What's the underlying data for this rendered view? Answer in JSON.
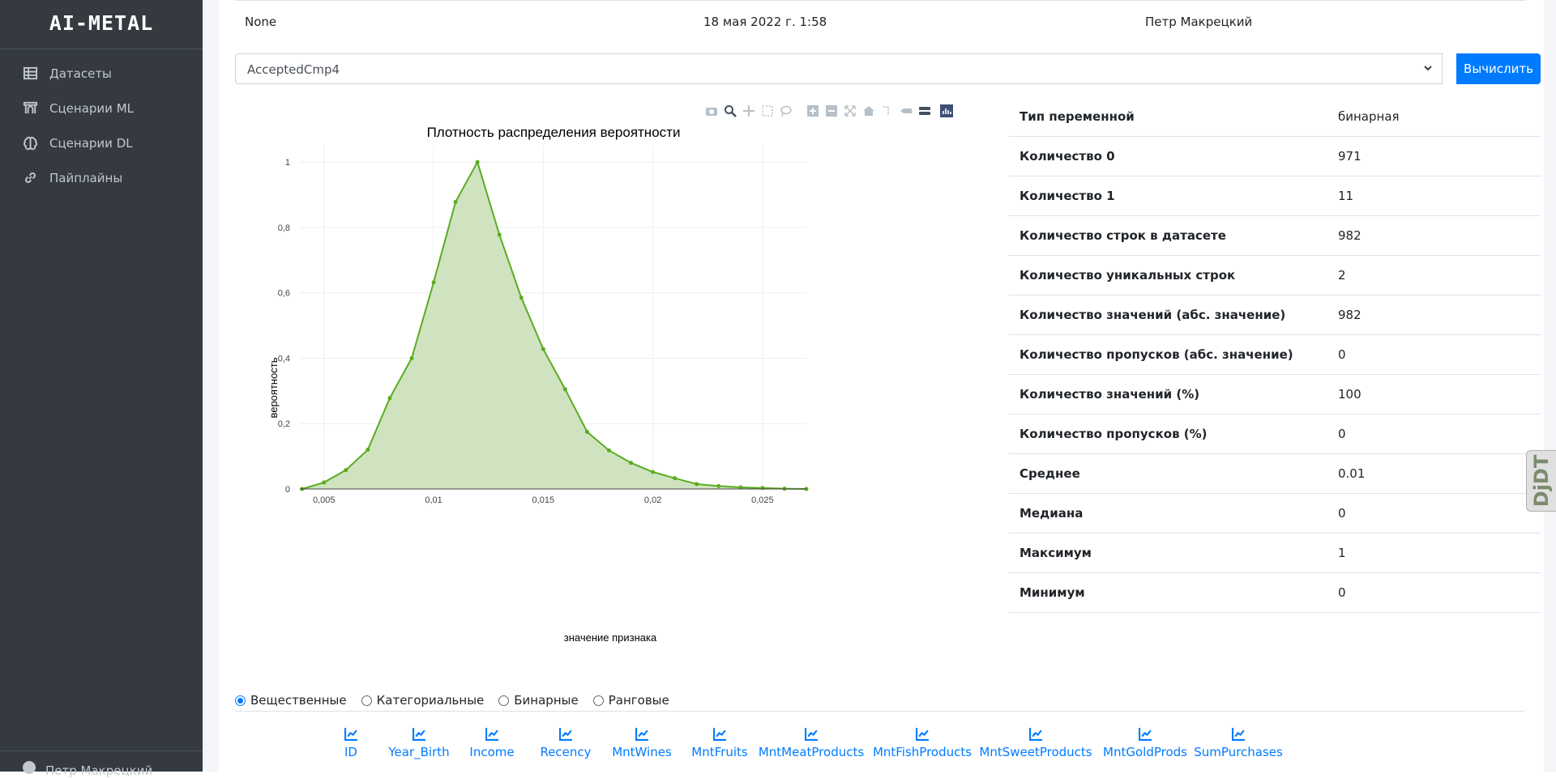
{
  "sidebar": {
    "brand": "AI-METAL",
    "items": [
      {
        "label": "Датасеты",
        "icon": "table-icon"
      },
      {
        "label": "Сценарии ML",
        "icon": "archway-icon"
      },
      {
        "label": "Сценарии DL",
        "icon": "brain-icon"
      },
      {
        "label": "Пайплайны",
        "icon": "link-icon"
      }
    ],
    "user": "Петр Макрецкий"
  },
  "info_row": {
    "col1": "None",
    "col2": "18 мая 2022 г. 1:58",
    "col3": "Петр Макрецкий"
  },
  "select": {
    "value": "AcceptedCmp4"
  },
  "compute_button": "Вычислить",
  "chart_data": {
    "type": "area",
    "title": "Плотность распределения вероятности",
    "xlabel": "значение признака",
    "ylabel": "вероятность",
    "xlim": [
      0.0039,
      0.027
    ],
    "ylim": [
      0,
      1.05
    ],
    "x_ticks": [
      0.005,
      0.01,
      0.015,
      0.02,
      0.025
    ],
    "x_tick_labels": [
      "0,005",
      "0,01",
      "0,015",
      "0,02",
      "0,025"
    ],
    "y_ticks": [
      0,
      0.2,
      0.4,
      0.6,
      0.8,
      1
    ],
    "y_tick_labels": [
      "0",
      "0,2",
      "0,4",
      "0,6",
      "0,8",
      "1"
    ],
    "grid": true,
    "color": "#5aac1f",
    "fill": "#cfe3c1",
    "x": [
      0.004,
      0.005,
      0.006,
      0.007,
      0.008,
      0.009,
      0.01,
      0.011,
      0.012,
      0.013,
      0.014,
      0.015,
      0.016,
      0.017,
      0.018,
      0.019,
      0.02,
      0.021,
      0.022,
      0.023,
      0.024,
      0.025,
      0.026,
      0.027
    ],
    "y": [
      0.0,
      0.02,
      0.058,
      0.12,
      0.278,
      0.4,
      0.632,
      0.878,
      1.0,
      0.778,
      0.585,
      0.428,
      0.305,
      0.175,
      0.118,
      0.08,
      0.052,
      0.033,
      0.015,
      0.009,
      0.005,
      0.003,
      0.001,
      0.0
    ]
  },
  "modebar": [
    "camera-icon",
    "zoom-icon",
    "pan-icon",
    "box-select-icon",
    "lasso-icon",
    "zoom-in-icon",
    "zoom-out-icon",
    "autoscale-icon",
    "home-icon",
    "spike-lines-icon",
    "hover-closest-icon",
    "hover-compare-icon",
    "plotly-logo-icon"
  ],
  "stats": [
    {
      "label": "Тип переменной",
      "value": "бинарная"
    },
    {
      "label": "Количество 0",
      "value": "971"
    },
    {
      "label": "Количество 1",
      "value": "11"
    },
    {
      "label": "Количество строк в датасете",
      "value": "982"
    },
    {
      "label": "Количество уникальных строк",
      "value": "2"
    },
    {
      "label": "Количество значений (абс. значение)",
      "value": "982"
    },
    {
      "label": "Количество пропусков (абс. значение)",
      "value": "0"
    },
    {
      "label": "Количество значений (%)",
      "value": "100"
    },
    {
      "label": "Количество пропусков (%)",
      "value": "0"
    },
    {
      "label": "Среднее",
      "value": "0.01"
    },
    {
      "label": "Медиана",
      "value": "0"
    },
    {
      "label": "Максимум",
      "value": "1"
    },
    {
      "label": "Минимум",
      "value": "0"
    }
  ],
  "radios": [
    {
      "label": "Вещественные",
      "checked": true
    },
    {
      "label": "Категориальные",
      "checked": false
    },
    {
      "label": "Бинарные",
      "checked": false
    },
    {
      "label": "Ранговые",
      "checked": false
    }
  ],
  "features": [
    "ID",
    "Year_Birth",
    "Income",
    "Recency",
    "MntWines",
    "MntFruits",
    "MntMeatProducts",
    "MntFishProducts",
    "MntSweetProducts",
    "MntGoldProds",
    "SumPurchases"
  ],
  "extension_badge": "DjDT"
}
